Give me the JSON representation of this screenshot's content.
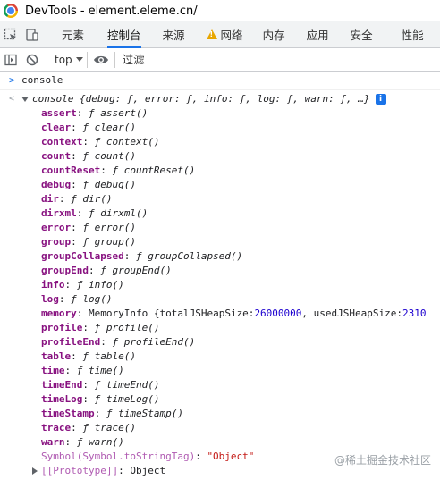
{
  "window": {
    "title": "DevTools - element.eleme.cn/"
  },
  "tabs": [
    {
      "label": "元素",
      "active": false
    },
    {
      "label": "控制台",
      "active": true
    },
    {
      "label": "来源",
      "active": false
    },
    {
      "label": "网络",
      "active": false,
      "warning": true
    },
    {
      "label": "内存",
      "active": false
    },
    {
      "label": "应用",
      "active": false
    },
    {
      "label": "安全",
      "active": false
    },
    {
      "label": "性能",
      "active": false
    }
  ],
  "toolbar": {
    "context": "top",
    "filter_placeholder": "过滤"
  },
  "console": {
    "input": "console",
    "summary": "console {debug: ƒ, error: ƒ, info: ƒ, log: ƒ, warn: ƒ, …}",
    "properties": [
      {
        "key": "assert",
        "value": "ƒ assert()"
      },
      {
        "key": "clear",
        "value": "ƒ clear()"
      },
      {
        "key": "context",
        "value": "ƒ context()"
      },
      {
        "key": "count",
        "value": "ƒ count()"
      },
      {
        "key": "countReset",
        "value": "ƒ countReset()"
      },
      {
        "key": "debug",
        "value": "ƒ debug()"
      },
      {
        "key": "dir",
        "value": "ƒ dir()"
      },
      {
        "key": "dirxml",
        "value": "ƒ dirxml()"
      },
      {
        "key": "error",
        "value": "ƒ error()"
      },
      {
        "key": "group",
        "value": "ƒ group()"
      },
      {
        "key": "groupCollapsed",
        "value": "ƒ groupCollapsed()"
      },
      {
        "key": "groupEnd",
        "value": "ƒ groupEnd()"
      },
      {
        "key": "info",
        "value": "ƒ info()"
      },
      {
        "key": "log",
        "value": "ƒ log()"
      },
      {
        "key": "memory",
        "value": "MemoryInfo {totalJSHeapSize: ",
        "num1": "26000000",
        "mid": ", usedJSHeapSize: ",
        "num2": "2310"
      },
      {
        "key": "profile",
        "value": "ƒ profile()"
      },
      {
        "key": "profileEnd",
        "value": "ƒ profileEnd()"
      },
      {
        "key": "table",
        "value": "ƒ table()"
      },
      {
        "key": "time",
        "value": "ƒ time()"
      },
      {
        "key": "timeEnd",
        "value": "ƒ timeEnd()"
      },
      {
        "key": "timeLog",
        "value": "ƒ timeLog()"
      },
      {
        "key": "timeStamp",
        "value": "ƒ timeStamp()"
      },
      {
        "key": "trace",
        "value": "ƒ trace()"
      },
      {
        "key": "warn",
        "value": "ƒ warn()"
      }
    ],
    "symbol_key": "Symbol(Symbol.toStringTag)",
    "symbol_value": "\"Object\"",
    "prototype_key": "[[Prototype]]",
    "prototype_value": "Object"
  },
  "watermark": "@稀土掘金技术社区"
}
